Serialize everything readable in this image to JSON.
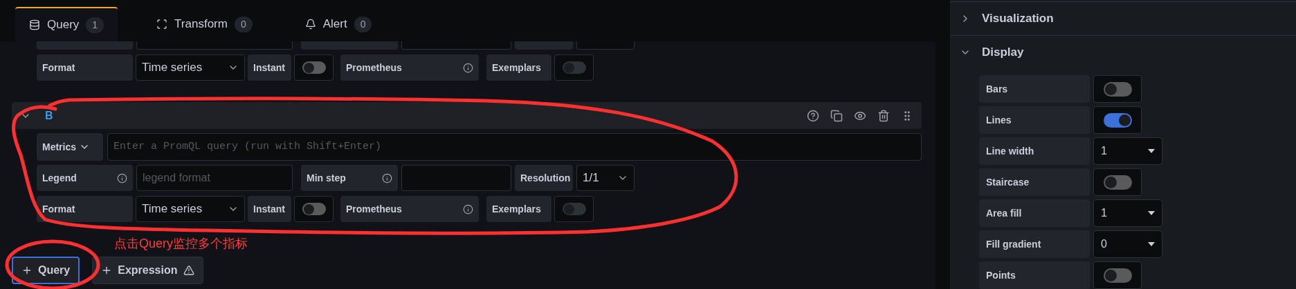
{
  "tabs": [
    {
      "kind": "query",
      "label": "Query",
      "count": "1",
      "selected": true
    },
    {
      "kind": "transform",
      "label": "Transform",
      "count": "0",
      "selected": false
    },
    {
      "kind": "alert",
      "label": "Alert",
      "count": "0",
      "selected": false
    }
  ],
  "query_a": {
    "format": {
      "label": "Format",
      "value": "Time series"
    },
    "instant": {
      "label": "Instant",
      "on": false
    },
    "datasource": {
      "label": "Prometheus"
    },
    "exemplars": {
      "label": "Exemplars",
      "on": false
    }
  },
  "query_b": {
    "name": "B",
    "expanded": true,
    "metrics": {
      "label": "Metrics",
      "placeholder": "Enter a PromQL query (run with Shift+Enter)"
    },
    "legend": {
      "label": "Legend",
      "placeholder": "legend format"
    },
    "min_step": {
      "label": "Min step"
    },
    "resolution": {
      "label": "Resolution",
      "value": "1/1"
    },
    "format": {
      "label": "Format",
      "value": "Time series"
    },
    "instant": {
      "label": "Instant",
      "on": false
    },
    "datasource": {
      "label": "Prometheus"
    },
    "exemplars": {
      "label": "Exemplars",
      "on": false
    }
  },
  "annotation": {
    "text": "点击Query监控多个指标"
  },
  "add_buttons": [
    {
      "kind": "query",
      "label": "Query",
      "focused": true
    },
    {
      "kind": "expression",
      "label": "Expression",
      "focused": false
    }
  ],
  "options_panel": {
    "sections": [
      {
        "title": "Visualization",
        "expanded": false
      },
      {
        "title": "Display",
        "expanded": true,
        "rows": [
          {
            "kind": "switch",
            "label": "Bars",
            "on": false
          },
          {
            "kind": "switch",
            "label": "Lines",
            "on": true
          },
          {
            "kind": "select",
            "label": "Line width",
            "value": "1"
          },
          {
            "kind": "switch",
            "label": "Staircase",
            "on": false
          },
          {
            "kind": "select",
            "label": "Area fill",
            "value": "1"
          },
          {
            "kind": "select",
            "label": "Fill gradient",
            "value": "0"
          },
          {
            "kind": "switch",
            "label": "Points",
            "on": false
          }
        ]
      }
    ]
  }
}
